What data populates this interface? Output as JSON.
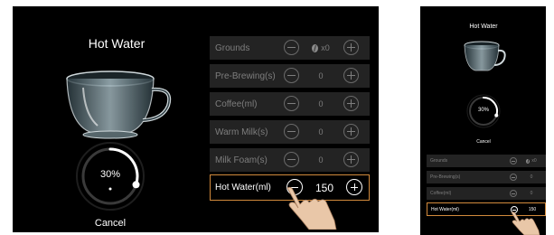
{
  "large": {
    "title": "Hot Water",
    "progress_label": "30%",
    "progress_value": 0.3,
    "cancel_label": "Cancel",
    "rows": [
      {
        "label": "Grounds",
        "value": "x0",
        "has_bean": true,
        "active": false
      },
      {
        "label": "Pre-Brewing(s)",
        "value": "0",
        "has_bean": false,
        "active": false
      },
      {
        "label": "Coffee(ml)",
        "value": "0",
        "has_bean": false,
        "active": false
      },
      {
        "label": "Warm Milk(s)",
        "value": "0",
        "has_bean": false,
        "active": false
      },
      {
        "label": "Milk Foam(s)",
        "value": "0",
        "has_bean": false,
        "active": false
      },
      {
        "label": "Hot Water(ml)",
        "value": "150",
        "has_bean": false,
        "active": true
      }
    ]
  },
  "small": {
    "title": "Hot Water",
    "progress_label": "30%",
    "progress_value": 0.3,
    "cancel_label": "Cancel",
    "rows": [
      {
        "label": "Grounds",
        "value": "x0",
        "has_bean": true,
        "active": false
      },
      {
        "label": "Pre-Brewing(s)",
        "value": "0",
        "has_bean": false,
        "active": false
      },
      {
        "label": "Coffee(ml)",
        "value": "0",
        "has_bean": false,
        "active": false
      },
      {
        "label": "Hot Water(ml)",
        "value": "150",
        "has_bean": false,
        "active": true
      }
    ]
  },
  "colors": {
    "background": "#000000",
    "row_bg": "#232323",
    "active_border": "#d28a3c",
    "dial_track": "#3a3a3a",
    "dial_fill": "#ffffff"
  }
}
